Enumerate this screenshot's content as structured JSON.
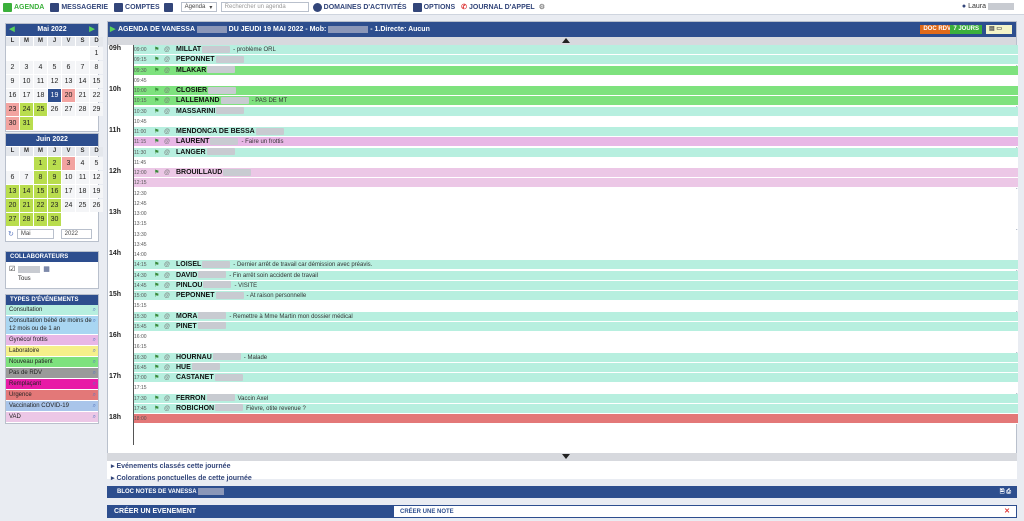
{
  "nav": {
    "agenda": "AGENDA",
    "messagerie": "MESSAGERIE",
    "comptes": "COMPTES",
    "agenda_select": "Agenda",
    "search_placeholder": "Rechercher un agenda",
    "domaines": "DOMAINES D'ACTIVITÉS",
    "options": "OPTIONS",
    "journal": "JOURNAL D'APPEL",
    "user": "Laura"
  },
  "cal1": {
    "title": "Mai 2022",
    "headers": [
      "L",
      "M",
      "M",
      "J",
      "V",
      "S",
      "D"
    ],
    "days": [
      [
        "",
        "",
        "",
        "",
        "",
        "",
        "1"
      ],
      [
        "2",
        "3",
        "4",
        "5",
        "6",
        "7",
        "8"
      ],
      [
        "9",
        "10",
        "11",
        "12",
        "13",
        "14",
        "15"
      ],
      [
        "16",
        "17",
        "18",
        "19",
        "20",
        "21",
        "22"
      ],
      [
        "23",
        "24",
        "25",
        "26",
        "27",
        "28",
        "29"
      ],
      [
        "30",
        "31",
        "",
        "",
        "",
        "",
        ""
      ]
    ]
  },
  "cal2": {
    "title": "Juin 2022",
    "headers": [
      "L",
      "M",
      "M",
      "J",
      "V",
      "S",
      "D"
    ],
    "days": [
      [
        "",
        "",
        "1",
        "2",
        "3",
        "4",
        "5"
      ],
      [
        "6",
        "7",
        "8",
        "9",
        "10",
        "11",
        "12"
      ],
      [
        "13",
        "14",
        "15",
        "16",
        "17",
        "18",
        "19"
      ],
      [
        "20",
        "21",
        "22",
        "23",
        "24",
        "25",
        "26"
      ],
      [
        "27",
        "28",
        "29",
        "30",
        "",
        "",
        ""
      ]
    ]
  },
  "month_select": "Mai",
  "year_select": "2022",
  "collab": {
    "title": "COLLABORATEURS",
    "all": "Tous"
  },
  "types": {
    "title": "TYPES D'ÉVÉNEMENTS",
    "items": [
      {
        "label": "Consultation",
        "color": "#b7efdf"
      },
      {
        "label": "Consultation bébé de moins de 12 mois ou de 1 an",
        "color": "#a9d6f2"
      },
      {
        "label": "Gynéco/ frottis",
        "color": "#e8b7e6"
      },
      {
        "label": "Laboratoire",
        "color": "#f5f08a"
      },
      {
        "label": "Nouveau patient",
        "color": "#7ee27e"
      },
      {
        "label": "Pas de RDV",
        "color": "#9a9a9a"
      },
      {
        "label": "Remplaçant",
        "color": "#e81aa6"
      },
      {
        "label": "Urgence",
        "color": "#e37878"
      },
      {
        "label": "Vaccination COVID-19",
        "color": "#a9c5ea"
      },
      {
        "label": "VAD",
        "color": "#ecc7e6"
      }
    ]
  },
  "agenda": {
    "title": "AGENDA DE VANESSA",
    "date": "DU JEUDI 19 MAI 2022 - Mob:",
    "ligne": "- 1.Directe: Aucun",
    "doc_rdv": "DOC RDV",
    "sept_jours": "7 JOURS"
  },
  "hours": [
    "09h",
    "10h",
    "11h",
    "12h",
    "13h",
    "14h",
    "15h",
    "16h",
    "17h",
    "18h"
  ],
  "rows": [
    {
      "t": "09:00",
      "n": "MILLAT",
      "c": "- problème ORL",
      "col": "#b7efdf"
    },
    {
      "t": "09:15",
      "n": "PEPONNET",
      "c": "",
      "col": "#b7efdf"
    },
    {
      "t": "09:30",
      "n": "MLAKAR",
      "c": "",
      "col": "#7ee27e"
    },
    {
      "t": "09:45",
      "n": "",
      "c": "",
      "col": "#fff"
    },
    {
      "t": "10:00",
      "n": "CLOSIER",
      "c": "",
      "col": "#7ee27e"
    },
    {
      "t": "10:15",
      "n": "LALLEMAND",
      "c": "- PAS DE MT",
      "col": "#7ee27e"
    },
    {
      "t": "10:30",
      "n": "MASSARINI",
      "c": "",
      "col": "#b7efdf"
    },
    {
      "t": "10:45",
      "n": "",
      "c": "",
      "col": "#fff"
    },
    {
      "t": "11:00",
      "n": "MENDONCA DE BESSA",
      "c": "",
      "col": "#b7efdf"
    },
    {
      "t": "11:15",
      "n": "LAURENT",
      "c": "- Faire un frottis",
      "col": "#e8b7e6"
    },
    {
      "t": "11:30",
      "n": "LANGER",
      "c": "",
      "col": "#b7efdf"
    },
    {
      "t": "11:45",
      "n": "",
      "c": "",
      "col": "#fff"
    },
    {
      "t": "12:00",
      "n": "BROUILLAUD",
      "c": "",
      "col": "#ecc7e6"
    },
    {
      "t": "12:15",
      "n": "",
      "c": "",
      "col": "#ecc7e6"
    },
    {
      "t": "12:30",
      "n": "",
      "c": "",
      "col": "#fff"
    },
    {
      "t": "12:45",
      "n": "",
      "c": "",
      "col": "#fff"
    },
    {
      "t": "13:00",
      "n": "",
      "c": "",
      "col": "#fff"
    },
    {
      "t": "13:15",
      "n": "",
      "c": "",
      "col": "#fff"
    },
    {
      "t": "13:30",
      "n": "",
      "c": "",
      "col": "#fff"
    },
    {
      "t": "13:45",
      "n": "",
      "c": "",
      "col": "#fff"
    },
    {
      "t": "14:00",
      "n": "",
      "c": "",
      "col": "#fff"
    },
    {
      "t": "14:15",
      "n": "LOISEL",
      "c": "- Dernier arrêt de travail car démission avec préavis.",
      "col": "#b7efdf"
    },
    {
      "t": "14:30",
      "n": "DAVID",
      "c": "- Fin arrêt soin accident de travail",
      "col": "#b7efdf"
    },
    {
      "t": "14:45",
      "n": "PINLOU",
      "c": "- VISITE",
      "col": "#b7efdf"
    },
    {
      "t": "15:00",
      "n": "PEPONNET",
      "c": "- At raison personnelle",
      "col": "#b7efdf"
    },
    {
      "t": "15:15",
      "n": "",
      "c": "",
      "col": "#fff"
    },
    {
      "t": "15:30",
      "n": "MORA",
      "c": "- Remettre à Mme Martin mon dossier médical",
      "col": "#b7efdf"
    },
    {
      "t": "15:45",
      "n": "PINET",
      "c": "",
      "col": "#b7efdf"
    },
    {
      "t": "16:00",
      "n": "",
      "c": "",
      "col": "#fff"
    },
    {
      "t": "16:15",
      "n": "",
      "c": "",
      "col": "#fff"
    },
    {
      "t": "16:30",
      "n": "HOURNAU",
      "c": "- Malade",
      "col": "#b7efdf"
    },
    {
      "t": "16:45",
      "n": "HUE",
      "c": "",
      "col": "#b7efdf"
    },
    {
      "t": "17:00",
      "n": "CASTANET",
      "c": "",
      "col": "#b7efdf"
    },
    {
      "t": "17:15",
      "n": "",
      "c": "",
      "col": "#fff"
    },
    {
      "t": "17:30",
      "n": "FERRON",
      "c": "Vaccin Axel",
      "col": "#b7efdf"
    },
    {
      "t": "17:45",
      "n": "ROBICHON",
      "c": "Fièvre, otite revenue ?",
      "col": "#b7efdf"
    },
    {
      "t": "18:00",
      "n": "",
      "c": "",
      "col": "#e37878"
    }
  ],
  "footer": {
    "ev_classes": "Evénements classés cette journée",
    "colorations": "Colorations ponctuelles de cette journée"
  },
  "bloc": "BLOC NOTES DE VANESSA",
  "create_event": "CRÉER UN EVENEMENT",
  "create_note": "CRÉER UNE NOTE"
}
